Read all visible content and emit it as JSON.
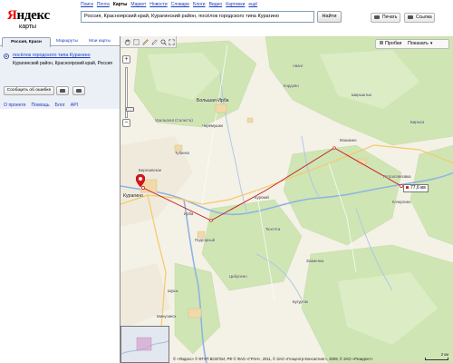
{
  "header": {
    "logo_text": "Яндекс",
    "logo_sub": "карты",
    "services": [
      "Поиск",
      "Почта",
      "Карты",
      "Маркет",
      "Новости",
      "Словари",
      "Блоги",
      "Видео",
      "Картинки",
      "ещё"
    ],
    "active_service": "Карты",
    "search_value": "Россия, Красноярский край, Курагинский район, посёлок городского типа Курагино",
    "find_label": "Найти",
    "print_label": "Печать",
    "link_label": "Ссылка"
  },
  "sidebar": {
    "tabs": [
      {
        "label": "Россия, Красн",
        "active": true
      },
      {
        "label": "Маршруты",
        "active": false
      },
      {
        "label": "Мои карты",
        "active": false
      }
    ],
    "result_title": "посёлок городского типа Курагино",
    "result_subtitle": "Курагинский район, Красноярский край, Россия",
    "report_label": "Сообщить об ошибке",
    "footer_links": [
      "О проекте",
      "Помощь",
      "Блог",
      "API"
    ]
  },
  "map": {
    "traffic_label": "Пробки",
    "show_label": "Показать",
    "distance_label": "77,6 км",
    "copyright": "© «Яндекс» © ФГУП ВСЕГЕИ, РФ © ФАО «ГРАН», 2011, © ЗАО «Геоцентр-Консалтинг», 2009, © ЗАО «Резидент»",
    "scale_label": "2 км",
    "route_color": "#c8141e",
    "places": [
      {
        "name": "Большая Ирба",
        "big": true
      },
      {
        "name": "Курагино",
        "big": true
      },
      {
        "name": "Тубинск",
        "big": false
      },
      {
        "name": "Черёмушки",
        "big": false
      },
      {
        "name": "Кордово",
        "big": false
      },
      {
        "name": "Уральская (Салиста)",
        "big": false
      },
      {
        "name": "Мошкино",
        "big": false
      },
      {
        "name": "Березовское",
        "big": false
      },
      {
        "name": "Курский",
        "big": false
      },
      {
        "name": "Ирба",
        "big": false
      },
      {
        "name": "Подгорный",
        "big": false
      },
      {
        "name": "Аванг",
        "big": false
      },
      {
        "name": "Кочергино",
        "big": false
      },
      {
        "name": "Петропавловка",
        "big": false
      },
      {
        "name": "Минусинск",
        "big": false
      },
      {
        "name": "Цибулено",
        "big": false
      },
      {
        "name": "Бугуртак",
        "big": false
      },
      {
        "name": "Шушь",
        "big": false
      },
      {
        "name": "Тюхтята",
        "big": false
      },
      {
        "name": "Знаменка",
        "big": false
      },
      {
        "name": "Ширыштык",
        "big": false
      },
      {
        "name": "Бирюса",
        "big": false
      }
    ]
  }
}
